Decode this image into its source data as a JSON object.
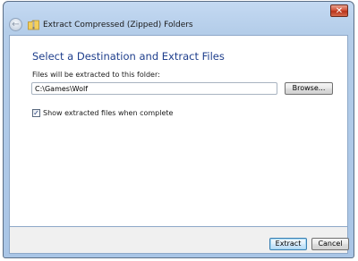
{
  "window": {
    "title": "Extract Compressed (Zipped) Folders",
    "close_label": "✕",
    "back_label": "←"
  },
  "main": {
    "heading": "Select a Destination and Extract Files",
    "destination_label": "Files will be extracted to this folder:",
    "destination_value": "C:\\Games\\Wolf",
    "browse_label": "Browse...",
    "show_files_checked": true,
    "show_files_mark": "✓",
    "show_files_label": "Show extracted files when complete"
  },
  "footer": {
    "extract_label": "Extract",
    "cancel_label": "Cancel"
  },
  "colors": {
    "heading": "#1e3e8c",
    "titlebar": "#b4cde9",
    "close": "#d3543a"
  },
  "icons": {
    "back": "back-arrow-icon",
    "folder": "zip-folder-icon",
    "close": "close-icon",
    "check": "checkmark-icon"
  }
}
